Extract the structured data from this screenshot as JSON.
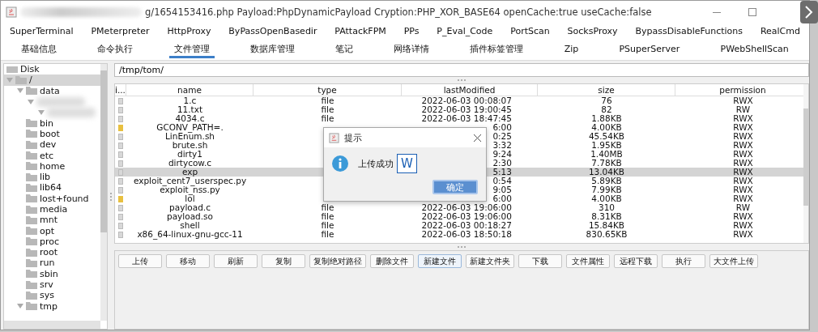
{
  "window": {
    "title": "g/1654153416.php Payload:PhpDynamicPayload Cryption:PHP_XOR_BASE64 openCache:true useCache:false"
  },
  "plugin_tabs": [
    {
      "label": "SuperTerminal",
      "selected": false
    },
    {
      "label": "PMeterpreter",
      "selected": false
    },
    {
      "label": "HttpProxy",
      "selected": false
    },
    {
      "label": "ByPassOpenBasedir",
      "selected": false
    },
    {
      "label": "PAttackFPM",
      "selected": false
    },
    {
      "label": "PPs",
      "selected": false
    },
    {
      "label": "P_Eval_Code",
      "selected": false
    },
    {
      "label": "PortScan",
      "selected": false
    },
    {
      "label": "SocksProxy",
      "selected": false
    },
    {
      "label": "BypassDisableFunctions",
      "selected": false
    },
    {
      "label": "RealCmd",
      "selected": false
    }
  ],
  "tabs": [
    {
      "label": "基础信息",
      "selected": false
    },
    {
      "label": "命令执行",
      "selected": false
    },
    {
      "label": "文件管理",
      "selected": true
    },
    {
      "label": "数据库管理",
      "selected": false
    },
    {
      "label": "笔记",
      "selected": false
    },
    {
      "label": "网络详情",
      "selected": false
    },
    {
      "label": "插件标签管理",
      "selected": false
    },
    {
      "label": "Zip",
      "selected": false
    },
    {
      "label": "PSuperServer",
      "selected": false
    },
    {
      "label": "PWebShellScan",
      "selected": false
    }
  ],
  "tree": [
    {
      "label": "Disk",
      "kind": "disk",
      "selected": false
    },
    {
      "label": "/",
      "kind": "folder",
      "selected": true,
      "expanded": true,
      "children": [
        {
          "label": "data",
          "kind": "folder",
          "selected": false,
          "expanded": true,
          "children": [
            {
              "kind": "blurred",
              "selected": false,
              "expanded": true,
              "children": [
                {
                  "kind": "blurred",
                  "selected": false,
                  "expanded": true
                }
              ]
            }
          ]
        },
        {
          "label": "bin",
          "kind": "folder",
          "selected": false
        },
        {
          "label": "boot",
          "kind": "folder",
          "selected": false
        },
        {
          "label": "dev",
          "kind": "folder",
          "selected": false
        },
        {
          "label": "etc",
          "kind": "folder",
          "selected": false
        },
        {
          "label": "home",
          "kind": "folder",
          "selected": false
        },
        {
          "label": "lib",
          "kind": "folder",
          "selected": false
        },
        {
          "label": "lib64",
          "kind": "folder",
          "selected": false
        },
        {
          "label": "lost+found",
          "kind": "folder",
          "selected": false
        },
        {
          "label": "media",
          "kind": "folder",
          "selected": false
        },
        {
          "label": "mnt",
          "kind": "folder",
          "selected": false
        },
        {
          "label": "opt",
          "kind": "folder",
          "selected": false
        },
        {
          "label": "proc",
          "kind": "folder",
          "selected": false
        },
        {
          "label": "root",
          "kind": "folder",
          "selected": false
        },
        {
          "label": "run",
          "kind": "folder",
          "selected": false
        },
        {
          "label": "sbin",
          "kind": "folder",
          "selected": false
        },
        {
          "label": "srv",
          "kind": "folder",
          "selected": false
        },
        {
          "label": "sys",
          "kind": "folder",
          "selected": false
        },
        {
          "label": "tmp",
          "kind": "folder",
          "selected": false,
          "expanded": true
        }
      ]
    }
  ],
  "path_field": {
    "value": "/tmp/tom/"
  },
  "table": {
    "columns": [
      "i...",
      "name",
      "type",
      "lastModified",
      "size",
      "permission"
    ],
    "rows": [
      {
        "kind": "file",
        "selected": false,
        "name": "1.c",
        "type": "file",
        "lastModified": "2022-06-03 00:08:07",
        "size": "76",
        "permission": "RWX"
      },
      {
        "kind": "file",
        "selected": false,
        "name": "11.txt",
        "type": "file",
        "lastModified": "2022-06-03 19:00:45",
        "size": "82",
        "permission": "RW"
      },
      {
        "kind": "file",
        "selected": false,
        "name": "4034.c",
        "type": "file",
        "lastModified": "2022-06-03 18:47:45",
        "size": "1.88KB",
        "permission": "RWX"
      },
      {
        "kind": "dir",
        "selected": false,
        "name": "GCONV_PATH=.",
        "lastModified": "6:00",
        "size": "4.00KB",
        "permission": "RWX"
      },
      {
        "kind": "file",
        "selected": false,
        "name": "LinEnum.sh",
        "lastModified": "0:25",
        "size": "45.54KB",
        "permission": "RWX"
      },
      {
        "kind": "file",
        "selected": false,
        "name": "brute.sh",
        "lastModified": "3:32",
        "size": "1.95KB",
        "permission": "RWX"
      },
      {
        "kind": "file",
        "selected": false,
        "name": "dirty1",
        "lastModified": "9:24",
        "size": "1.40MB",
        "permission": "RWX"
      },
      {
        "kind": "file",
        "selected": false,
        "name": "dirtycow.c",
        "lastModified": "2:30",
        "size": "7.78KB",
        "permission": "RWX"
      },
      {
        "kind": "file",
        "selected": true,
        "name": "exp",
        "lastModified": "5:13",
        "size": "13.04KB",
        "permission": "RWX"
      },
      {
        "kind": "file",
        "selected": false,
        "name": "exploit_cent7_userspec.py",
        "lastModified": "0:54",
        "size": "5.89KB",
        "permission": "RWX"
      },
      {
        "kind": "file",
        "selected": false,
        "name": "exploit_nss.py",
        "lastModified": "9:05",
        "size": "7.99KB",
        "permission": "RWX"
      },
      {
        "kind": "dir",
        "selected": false,
        "name": "lol",
        "lastModified": "6:00",
        "size": "4.00KB",
        "permission": "RWX"
      },
      {
        "kind": "file",
        "selected": false,
        "name": "payload.c",
        "type": "file",
        "lastModified": "2022-06-03 19:06:00",
        "size": "310",
        "permission": "RW"
      },
      {
        "kind": "file",
        "selected": false,
        "name": "payload.so",
        "type": "file",
        "lastModified": "2022-06-03 19:06:00",
        "size": "8.31KB",
        "permission": "RWX"
      },
      {
        "kind": "file",
        "selected": false,
        "name": "shell",
        "type": "file",
        "lastModified": "2022-06-03 00:18:27",
        "size": "15.84KB",
        "permission": "RWX"
      },
      {
        "kind": "file",
        "selected": false,
        "name": "x86_64-linux-gnu-gcc-11",
        "type": "file",
        "lastModified": "2022-06-03 18:50:18",
        "size": "830.65KB",
        "permission": "RWX"
      }
    ]
  },
  "buttons": [
    {
      "label": "上传",
      "focused": false
    },
    {
      "label": "移动",
      "focused": false
    },
    {
      "label": "刷新",
      "focused": false
    },
    {
      "label": "复制",
      "focused": false
    },
    {
      "label": "复制绝对路径",
      "focused": false
    },
    {
      "label": "删除文件",
      "focused": false
    },
    {
      "label": "新建文件",
      "focused": true
    },
    {
      "label": "新建文件夹",
      "focused": false
    },
    {
      "label": "下载",
      "focused": false
    },
    {
      "label": "文件属性",
      "focused": false
    },
    {
      "label": "远程下载",
      "focused": false
    },
    {
      "label": "执行",
      "focused": false
    },
    {
      "label": "大文件上传",
      "focused": false
    }
  ],
  "dialog": {
    "title": "提示",
    "message": "上传成功",
    "badge": "W",
    "ok_button": "确定"
  }
}
